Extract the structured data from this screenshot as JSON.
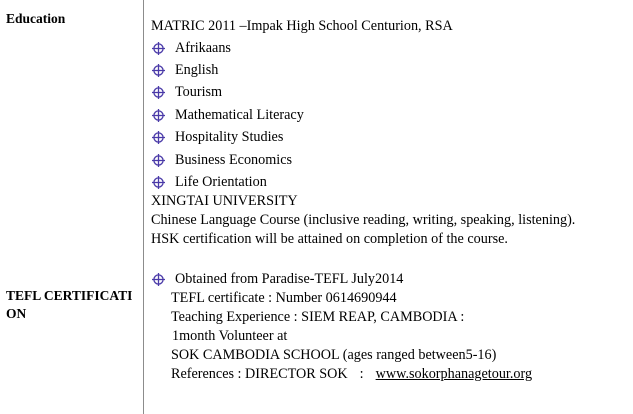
{
  "education": {
    "label": "Education",
    "matric": "MATRIC 2011 –Impak High School Centurion, RSA",
    "subjects": [
      "Afrikaans",
      "English",
      "Tourism",
      "Mathematical Literacy",
      "Hospitality Studies",
      "Business Economics",
      "Life Orientation"
    ],
    "university": "XINGTAI UNIVERSITY",
    "course": "Chinese Language Course (inclusive reading, writing, speaking, listening).",
    "hsk": "HSK certification will be attained on completion of the course."
  },
  "tefl": {
    "label": "TEFL CERTIFICATION",
    "obtained": "Obtained from Paradise-TEFL July2014",
    "certificate": "TEFL  certificate : Number 0614690944",
    "experience": "Teaching Experience : SIEM REAP, CAMBODIA :",
    "volunteer": "1month Volunteer at",
    "school": "SOK CAMBODIA SCHOOL (ages ranged between5-16)",
    "references_label": "References : DIRECTOR SOK",
    "references_sep": ":",
    "website": "www.sokorphanagetour.org"
  },
  "icons": {
    "bullet": "circle-crosshair-icon",
    "color": "#4a3aa8"
  }
}
